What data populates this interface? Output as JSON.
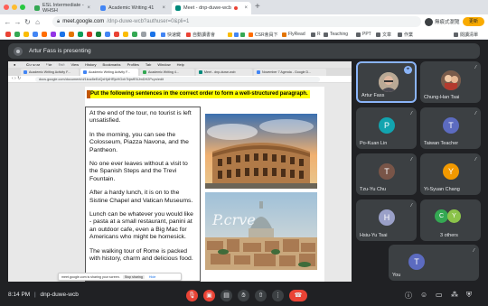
{
  "browser": {
    "tabs": [
      {
        "label": "ESL Intermediate - WHSH"
      },
      {
        "label": "Academic Writing 41"
      },
      {
        "label": "Meet - dnp-duwe-wcb"
      }
    ],
    "new_tab": "+",
    "url_host": "meet.google.com",
    "url_path": "/dnp-duwe-wcb?authuser=0&pli=1",
    "profile_label": "無痕式瀏覽",
    "update_label": "更新",
    "bookmarks": [
      {
        "label": "快速鍵"
      },
      {
        "label": "自動讀書會"
      },
      {
        "label": "CSR會員下"
      },
      {
        "label": "FlyRead"
      },
      {
        "label": "R"
      },
      {
        "label": "Teaching"
      },
      {
        "label": "PPT"
      },
      {
        "label": "文章"
      },
      {
        "label": "作業"
      },
      {
        "label": "閱讀清單"
      }
    ]
  },
  "presenting_banner": "Artur Fass is presenting",
  "shared_screen": {
    "menubar": [
      "Chrome",
      "File",
      "Edit",
      "View",
      "History",
      "Bookmarks",
      "Profiles",
      "Tab",
      "Window",
      "Help"
    ],
    "menubar_clock": "Sun Nov 7  7:14 AM",
    "tabs": [
      {
        "label": "Academic Writing Activity F..."
      },
      {
        "label": "Academic Writing Activity F..."
      },
      {
        "label": "Academic Writing 4..."
      },
      {
        "label": "Meet - dnp-duwe-wcb"
      },
      {
        "label": "November 7 Agenda - Google D..."
      }
    ],
    "url": "docs.google.com/document/d/1koz8eEdQxHjdHRjoHGxh7bjwfE6JmDH2Pcyn/edit",
    "instruction": "Put the following sentences in the correct order to form a well-structured paragraph.",
    "sentences": [
      "At the end of the tour, no tourist is left unsatisfied.",
      "In the morning, you can see the Colosseum, Piazza Navona, and the Pantheon.",
      "No one ever leaves without a visit to the Spanish Steps and the Trevi Fountain.",
      "After a hardy lunch, it is on to the Sistine Chapel and Vatican Museums.",
      "Lunch can be whatever you would like - pasta at a small restaurant, panini at an outdoor cafe, even a Big Mac for Americans who might be homesick.",
      "The walking tour of Rome is packed with history, charm and delicious food."
    ],
    "photo_watermark": "P.crve",
    "share_notice": "meet.google.com is sharing your screen.",
    "stop_sharing": "Stop sharing",
    "hide": "Hide"
  },
  "participants": [
    {
      "name": "Artur Fass",
      "initial": "",
      "color": "#c9b7a4",
      "pinned": true
    },
    {
      "name": "Chung-Han Tsai",
      "initial": "",
      "color": "#5f6368"
    },
    {
      "name": "Po-Kuan Lin",
      "initial": "P",
      "color": "#12a4af"
    },
    {
      "name": "Taiwan Teacher",
      "initial": "T",
      "color": "#5c6bc0"
    },
    {
      "name": "Tzu-Yu Chu",
      "initial": "T",
      "color": "#795548"
    },
    {
      "name": "Yi-Syuan Chang",
      "initial": "Y",
      "color": "#f29900"
    },
    {
      "name": "Hsiu-Yu Tsai",
      "initial": "H",
      "color": "#9aa0c8"
    },
    {
      "name": "3 others",
      "initial": "C",
      "initial2": "Y",
      "color": "#34a853",
      "color2": "#8bc34a"
    },
    {
      "name": "You",
      "initial": "T",
      "color": "#5c6bc0"
    }
  ],
  "bottom": {
    "time": "8:14 PM",
    "separator": "|",
    "meeting_code": "dnp-duwe-wcb"
  }
}
